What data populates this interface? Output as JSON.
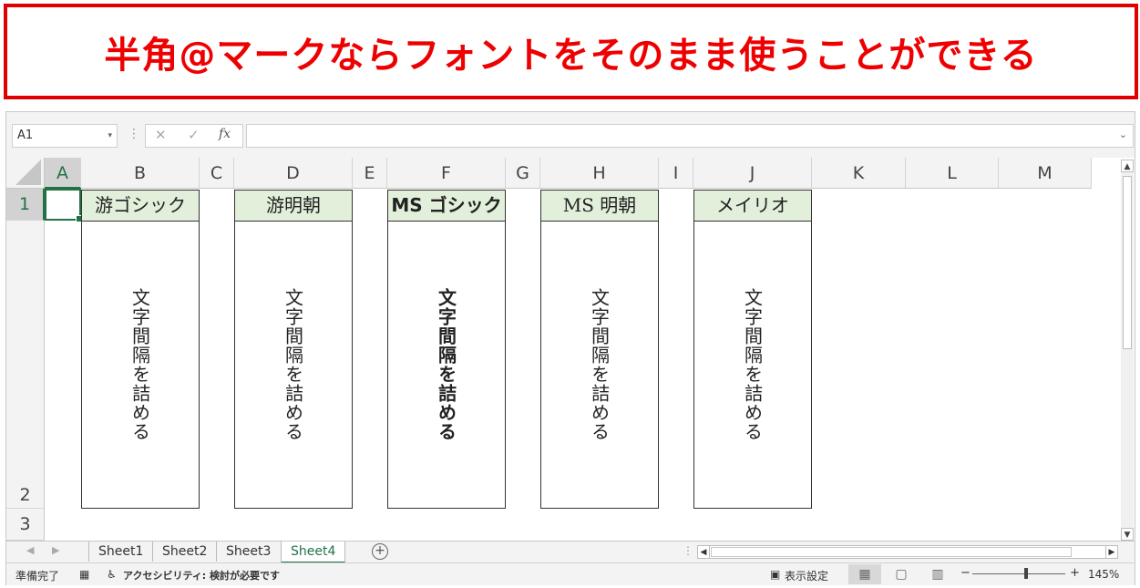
{
  "banner": {
    "text": "半角@マークならフォントをそのまま使うことができる"
  },
  "formula_bar": {
    "name_box": "A1",
    "cancel_glyph": "✕",
    "enter_glyph": "✓",
    "fx_label": "fx",
    "formula_value": ""
  },
  "columns": [
    "A",
    "B",
    "C",
    "D",
    "E",
    "F",
    "G",
    "H",
    "I",
    "J",
    "K",
    "L",
    "M"
  ],
  "rows": [
    "1",
    "2",
    "3"
  ],
  "cells": [
    {
      "col": "B",
      "header": "游ゴシック",
      "text": "文字間隔を詰める"
    },
    {
      "col": "D",
      "header": "游明朝",
      "text": "文字間隔を詰める"
    },
    {
      "col": "F",
      "header": "MS ゴシック",
      "text": "文字間隔を詰める"
    },
    {
      "col": "H",
      "header": "MS 明朝",
      "text": "文字間隔を詰める"
    },
    {
      "col": "J",
      "header": "メイリオ",
      "text": "文字間隔を詰める"
    }
  ],
  "sheets": [
    "Sheet1",
    "Sheet2",
    "Sheet3",
    "Sheet4"
  ],
  "active_sheet": "Sheet4",
  "status": {
    "ready": "準備完了",
    "accessibility": "アクセシビリティ: 検討が必要です",
    "display_settings": "表示設定",
    "zoom": "145%"
  },
  "colors": {
    "banner_red": "#ee0000",
    "excel_green": "#217346",
    "header_fill": "#e2efda"
  }
}
